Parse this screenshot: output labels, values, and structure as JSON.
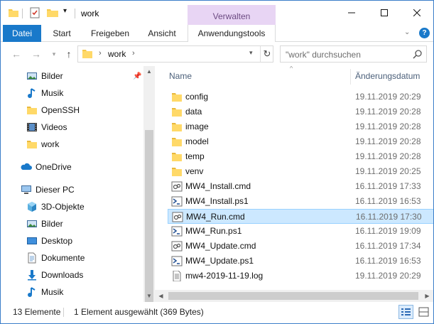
{
  "window": {
    "title": "work",
    "context_tab_group": "Verwalten"
  },
  "ribbon": {
    "tabs": [
      "Datei",
      "Start",
      "Freigeben",
      "Ansicht",
      "Anwendungstools"
    ]
  },
  "address": {
    "path": "work",
    "search_placeholder": "\"work\" durchsuchen"
  },
  "nav": {
    "quick_access": [
      {
        "label": "Bilder",
        "icon": "pictures-icon",
        "pinned": true
      },
      {
        "label": "Musik",
        "icon": "music-icon"
      },
      {
        "label": "OpenSSH",
        "icon": "folder-icon"
      },
      {
        "label": "Videos",
        "icon": "videos-icon"
      },
      {
        "label": "work",
        "icon": "folder-icon"
      }
    ],
    "onedrive": "OneDrive",
    "this_pc": "Dieser PC",
    "pc_items": [
      {
        "label": "3D-Objekte",
        "icon": "3d-objects-icon"
      },
      {
        "label": "Bilder",
        "icon": "pictures-icon"
      },
      {
        "label": "Desktop",
        "icon": "desktop-icon"
      },
      {
        "label": "Dokumente",
        "icon": "documents-icon"
      },
      {
        "label": "Downloads",
        "icon": "downloads-icon"
      },
      {
        "label": "Musik",
        "icon": "music-icon"
      }
    ]
  },
  "files": {
    "columns": {
      "name": "Name",
      "date": "Änderungsdatum"
    },
    "rows": [
      {
        "name": "config",
        "date": "19.11.2019 20:29",
        "type": "folder"
      },
      {
        "name": "data",
        "date": "19.11.2019 20:28",
        "type": "folder"
      },
      {
        "name": "image",
        "date": "19.11.2019 20:28",
        "type": "folder"
      },
      {
        "name": "model",
        "date": "19.11.2019 20:28",
        "type": "folder"
      },
      {
        "name": "temp",
        "date": "19.11.2019 20:28",
        "type": "folder"
      },
      {
        "name": "venv",
        "date": "19.11.2019 20:25",
        "type": "folder"
      },
      {
        "name": "MW4_Install.cmd",
        "date": "16.11.2019 17:33",
        "type": "cmd"
      },
      {
        "name": "MW4_Install.ps1",
        "date": "16.11.2019 16:53",
        "type": "ps1"
      },
      {
        "name": "MW4_Run.cmd",
        "date": "16.11.2019 17:30",
        "type": "cmd",
        "selected": true
      },
      {
        "name": "MW4_Run.ps1",
        "date": "16.11.2019 19:09",
        "type": "ps1"
      },
      {
        "name": "MW4_Update.cmd",
        "date": "16.11.2019 17:34",
        "type": "cmd"
      },
      {
        "name": "MW4_Update.ps1",
        "date": "16.11.2019 16:53",
        "type": "ps1"
      },
      {
        "name": "mw4-2019-11-19.log",
        "date": "19.11.2019 20:29",
        "type": "log"
      }
    ]
  },
  "status": {
    "count": "13 Elemente",
    "selection": "1 Element ausgewählt (369 Bytes)"
  },
  "colors": {
    "accent": "#1979ca",
    "context_tab": "#e8d5f4",
    "selection": "#cce8ff",
    "folder": "#f6c94a"
  }
}
